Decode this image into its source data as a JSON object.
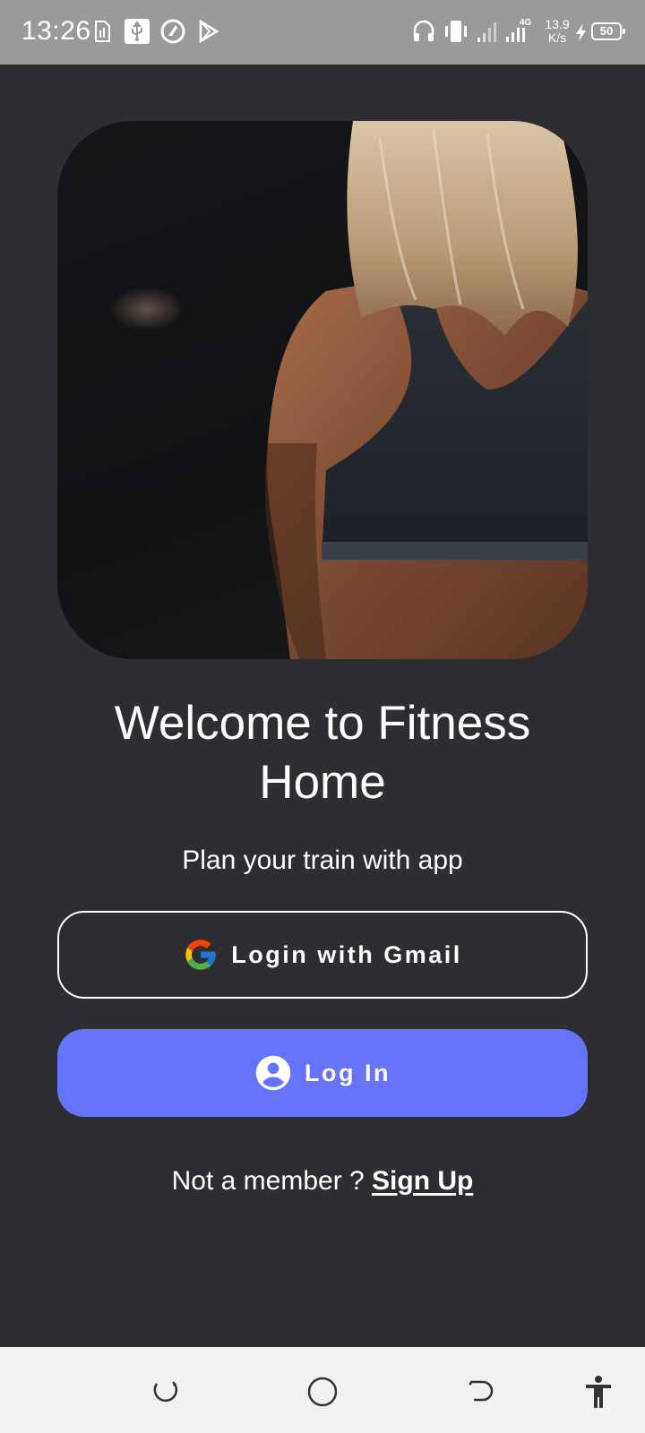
{
  "status_bar": {
    "time": "13:26",
    "net_speed_value": "13.9",
    "net_speed_unit": "K/s",
    "network_type": "4G",
    "battery_level": "50",
    "icons": [
      "sim-card-icon",
      "usb-icon",
      "vpn-icon",
      "play-store-icon",
      "headphones-icon",
      "vibrate-icon",
      "signal-icon",
      "signal-4g-icon",
      "charging-icon",
      "battery-icon"
    ]
  },
  "hero": {
    "image": "fitness-woman-back-photo"
  },
  "welcome": {
    "title": "Welcome to Fitness Home",
    "subtitle": "Plan your train with app"
  },
  "buttons": {
    "gmail_label": "Login with Gmail",
    "login_label": "Log In"
  },
  "signup": {
    "prompt": "Not a member ? ",
    "link_label": "Sign Up"
  },
  "colors": {
    "background": "#2e2d31",
    "status_bar": "#9a9a9a",
    "accent": "#6674fc",
    "nav_bar": "#f1f1f1"
  },
  "nav_bar": {
    "icons": [
      "recent-apps-icon",
      "home-icon",
      "back-icon",
      "accessibility-icon"
    ]
  }
}
